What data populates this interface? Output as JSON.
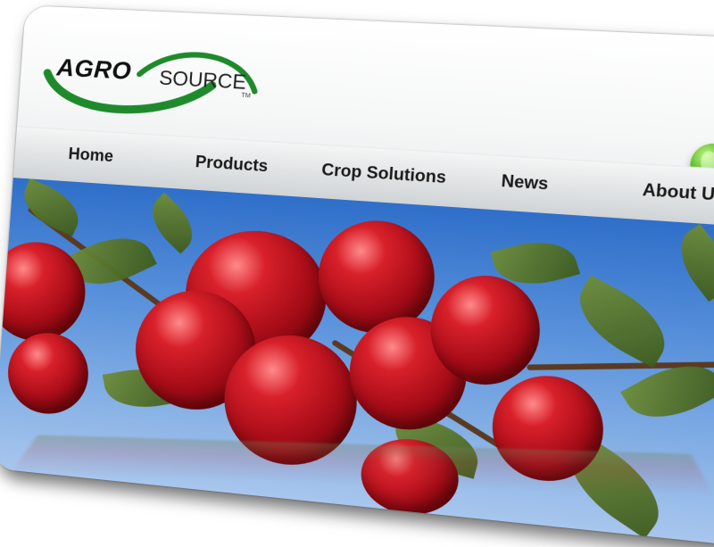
{
  "logo": {
    "agro": "AGRO",
    "source": "SOURCE",
    "tm": "TM"
  },
  "nav": {
    "items": [
      {
        "label": "Home"
      },
      {
        "label": "Products"
      },
      {
        "label": "Crop Solutions"
      },
      {
        "label": "News"
      },
      {
        "label": "About Us"
      }
    ]
  },
  "colors": {
    "logo_swoosh": "#1f8a2b",
    "globe": "#4aa82e",
    "nav_text": "#1a1a1a",
    "apple_red": "#c0131e",
    "sky": "#4d86d6"
  },
  "icons": {
    "globe": "globe-icon"
  },
  "hero": {
    "subject": "red apples on branch"
  }
}
